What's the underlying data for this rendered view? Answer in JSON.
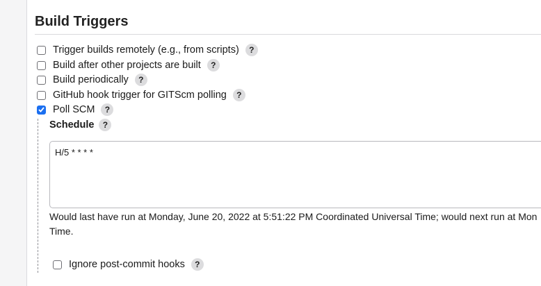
{
  "section": {
    "title": "Build Triggers"
  },
  "triggers": [
    {
      "label": "Trigger builds remotely (e.g., from scripts)",
      "checked": false,
      "help": "?"
    },
    {
      "label": "Build after other projects are built",
      "checked": false,
      "help": "?"
    },
    {
      "label": "Build periodically",
      "checked": false,
      "help": "?"
    },
    {
      "label": "GitHub hook trigger for GITScm polling",
      "checked": false,
      "help": "?"
    },
    {
      "label": "Poll SCM",
      "checked": true,
      "help": "?"
    }
  ],
  "poll_scm": {
    "schedule_label": "Schedule",
    "schedule_help": "?",
    "schedule_value": "H/5 * * * *",
    "run_info_line1": "Would last have run at Monday, June 20, 2022 at 5:51:22 PM Coordinated Universal Time; would next run at Mon",
    "run_info_line2": "Time.",
    "ignore_hooks": {
      "label": "Ignore post-commit hooks",
      "checked": false,
      "help": "?"
    }
  },
  "colors": {
    "accent": "#1b6ff0",
    "help_bg": "#dcdcde",
    "rail_bg": "#f5f5f6"
  }
}
